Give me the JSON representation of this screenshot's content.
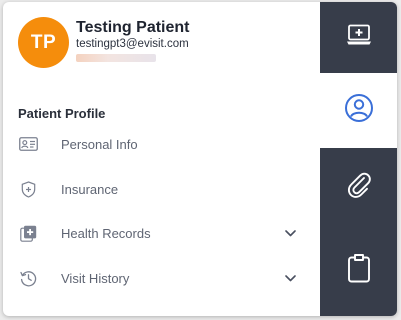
{
  "user": {
    "initials": "TP",
    "name": "Testing Patient",
    "email": "testingpt3@evisit.com"
  },
  "section": {
    "title": "Patient Profile"
  },
  "menu": [
    {
      "label": "Personal Info",
      "icon": "id-card-icon",
      "expandable": false
    },
    {
      "label": "Insurance",
      "icon": "shield-plus-icon",
      "expandable": false
    },
    {
      "label": "Health Records",
      "icon": "medical-records-icon",
      "expandable": true
    },
    {
      "label": "Visit History",
      "icon": "history-icon",
      "expandable": true
    }
  ],
  "rail": [
    {
      "icon": "telehealth-laptop-icon",
      "active": false
    },
    {
      "icon": "user-circle-icon",
      "active": true
    },
    {
      "icon": "paperclip-icon",
      "active": false
    },
    {
      "icon": "clipboard-icon",
      "active": false
    }
  ],
  "colors": {
    "avatar": "#f58d0c",
    "rail_dark": "#373d4a",
    "rail_active_icon": "#3a6fd8",
    "rail_icon": "#ffffff",
    "text_primary": "#1f2430",
    "text_secondary": "#5f6573"
  }
}
